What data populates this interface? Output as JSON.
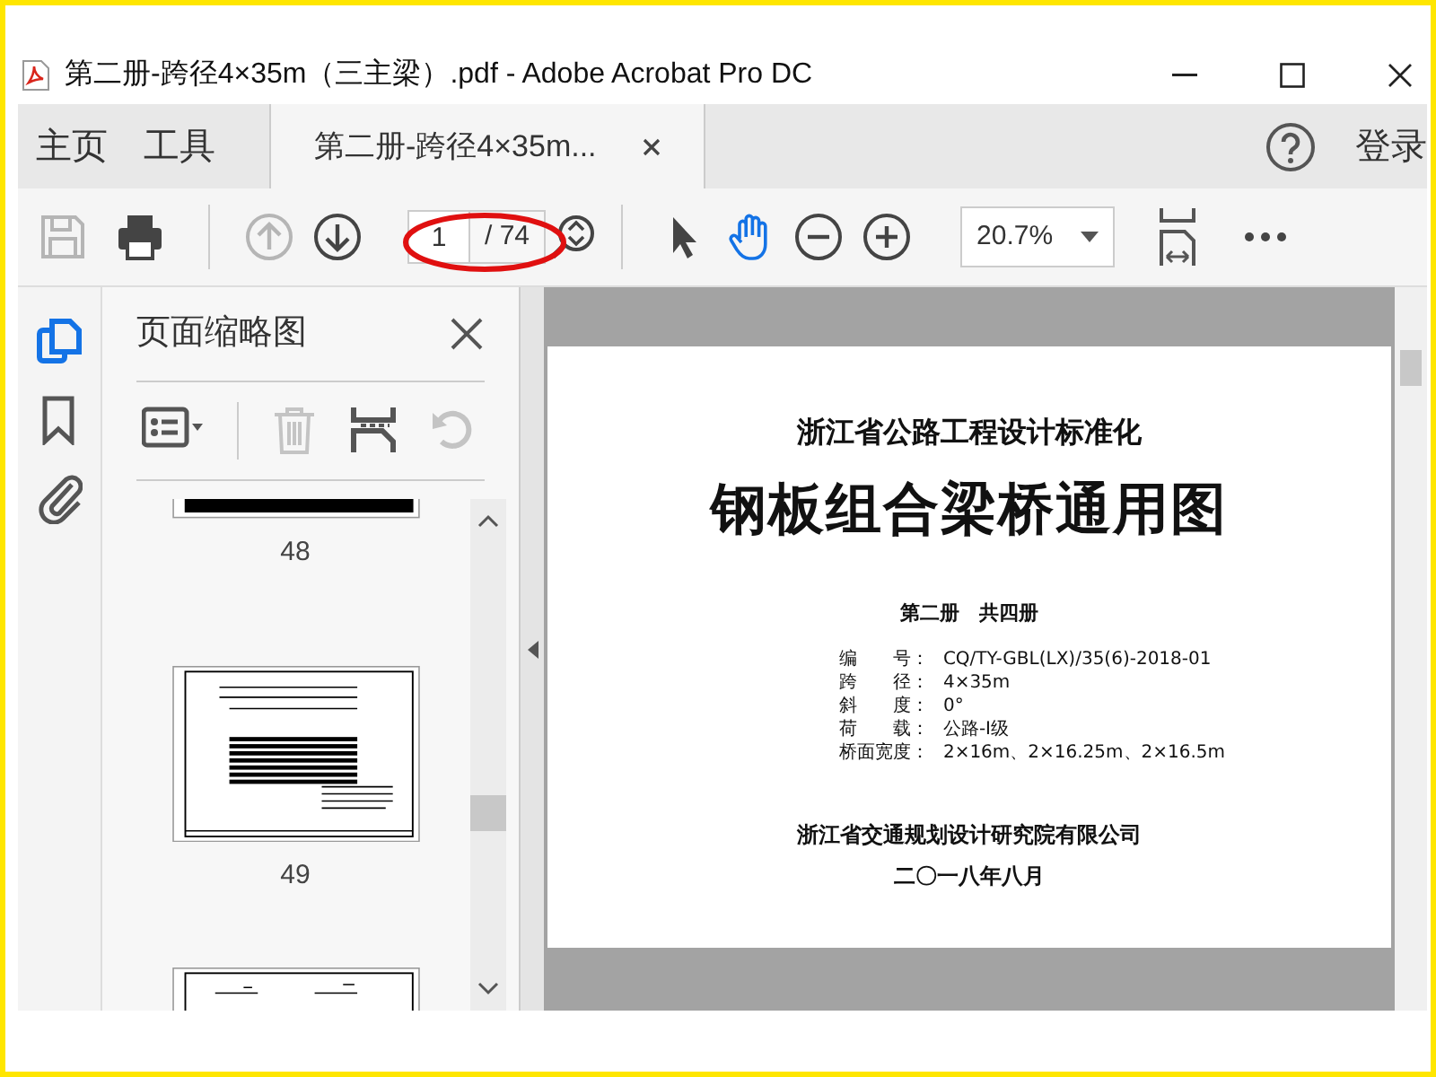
{
  "window": {
    "title": "第二册-跨径4×35m（三主梁）.pdf - Adobe Acrobat Pro DC"
  },
  "tabs": [
    {
      "kind": "nav",
      "label": "主页",
      "selected": false
    },
    {
      "kind": "nav",
      "label": "工具",
      "selected": false
    },
    {
      "kind": "document",
      "label": "第二册-跨径4×35m...",
      "selected": true
    }
  ],
  "account": {
    "label": "登录"
  },
  "toolbar": {
    "tools": [
      {
        "kind": "save",
        "disabled": true
      },
      {
        "kind": "print",
        "disabled": false
      },
      {
        "kind": "prev",
        "disabled": true
      },
      {
        "kind": "next",
        "disabled": false
      }
    ],
    "page": {
      "value": "1",
      "total": "/ 74"
    },
    "view_tools": [
      {
        "kind": "select",
        "selected": false
      },
      {
        "kind": "hand",
        "selected": true
      },
      {
        "kind": "zoom-out",
        "selected": false
      },
      {
        "kind": "zoom-in",
        "selected": false
      }
    ],
    "zoom": "20.7%"
  },
  "side_icons": [
    {
      "kind": "pages",
      "selected": true
    },
    {
      "kind": "bookmark",
      "selected": false
    },
    {
      "kind": "attachment",
      "selected": false
    }
  ],
  "panel": {
    "title": "页面缩略图",
    "tools": [
      {
        "kind": "options",
        "disabled": false
      },
      {
        "kind": "delete",
        "disabled": true
      },
      {
        "kind": "insert",
        "disabled": false
      },
      {
        "kind": "rotate",
        "disabled": true
      }
    ],
    "thumbnails": [
      {
        "label": "48"
      },
      {
        "label": "49"
      }
    ]
  },
  "document": {
    "subtitle": "浙江省公路工程设计标准化",
    "title": "钢板组合梁桥通用图",
    "volume": "第二册　共四册",
    "fields": [
      {
        "label": "编　　号：",
        "value": "CQ/TY-GBL(LX)/35(6)-2018-01"
      },
      {
        "label": "跨　　径：",
        "value": "4×35m"
      },
      {
        "label": "斜　　度：",
        "value": "0°"
      },
      {
        "label": "荷　　载：",
        "value": "公路-Ⅰ级"
      },
      {
        "label": "桥面宽度：",
        "value": "2×16m、2×16.25m、2×16.5m"
      }
    ],
    "publisher": "浙江省交通规划设计研究院有限公司",
    "date": "二〇一八年八月"
  }
}
